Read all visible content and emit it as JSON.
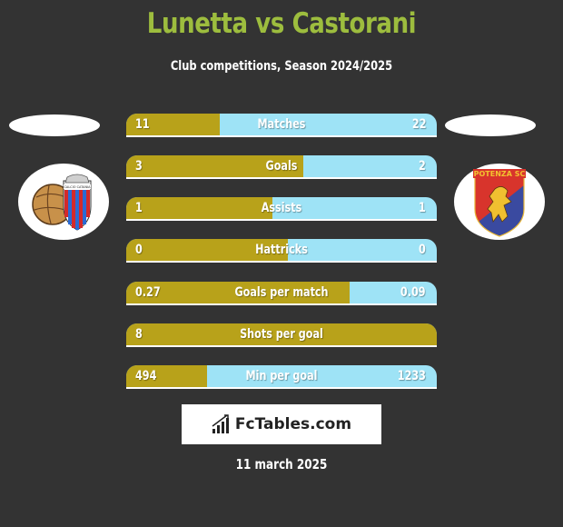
{
  "header": {
    "title": "Lunetta vs Castorani",
    "subtitle": "Club competitions, Season 2024/2025"
  },
  "players": {
    "left": {
      "name": "Lunetta",
      "club_logo": "catania-crest-icon"
    },
    "right": {
      "name": "Castorani",
      "club_logo": "potenza-crest-icon",
      "crest_text": "POTENZA SC"
    }
  },
  "colors": {
    "left_bar": "#b8a21a",
    "right_bar": "#9ee3f6",
    "title": "#9dbd3e",
    "background": "#333333"
  },
  "stats": [
    {
      "label": "Matches",
      "left": "11",
      "right": "22",
      "left_share": 0.3
    },
    {
      "label": "Goals",
      "left": "3",
      "right": "2",
      "left_share": 0.57
    },
    {
      "label": "Assists",
      "left": "1",
      "right": "1",
      "left_share": 0.47
    },
    {
      "label": "Hattricks",
      "left": "0",
      "right": "0",
      "left_share": 0.52
    },
    {
      "label": "Goals per match",
      "left": "0.27",
      "right": "0.09",
      "left_share": 0.72
    },
    {
      "label": "Shots per goal",
      "left": "8",
      "right": "",
      "left_share": 1.0
    },
    {
      "label": "Min per goal",
      "left": "494",
      "right": "1233",
      "left_share": 0.26
    }
  ],
  "brand": {
    "name": "FcTables.com",
    "icon": "bar-chart-icon"
  },
  "date": "11 march 2025"
}
